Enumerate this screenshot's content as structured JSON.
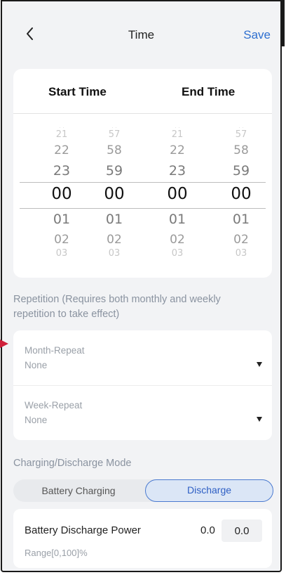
{
  "header": {
    "title": "Time",
    "save_label": "Save"
  },
  "picker": {
    "start_label": "Start Time",
    "end_label": "End Time",
    "start_hour": {
      "f1": "21",
      "f2": "22",
      "f3": "23",
      "sel": "00",
      "n1": "01",
      "n2": "02",
      "n3": "03"
    },
    "start_minute": {
      "f1": "57",
      "f2": "58",
      "f3": "59",
      "sel": "00",
      "n1": "01",
      "n2": "02",
      "n3": "03"
    },
    "end_hour": {
      "f1": "21",
      "f2": "22",
      "f3": "23",
      "sel": "00",
      "n1": "01",
      "n2": "02",
      "n3": "03"
    },
    "end_minute": {
      "f1": "57",
      "f2": "58",
      "f3": "59",
      "sel": "00",
      "n1": "01",
      "n2": "02",
      "n3": "03"
    }
  },
  "repetition": {
    "label": "Repetition (Requires both monthly and weekly repetition to take effect)",
    "month": {
      "name": "Month-Repeat",
      "value": "None"
    },
    "week": {
      "name": "Week-Repeat",
      "value": "None"
    }
  },
  "mode": {
    "label": "Charging/Discharge Mode",
    "options": [
      "Battery Charging",
      "Discharge"
    ],
    "selected": "Discharge"
  },
  "power": {
    "label": "Battery Discharge Power",
    "value": "0.0",
    "input_value": "0.0",
    "range": "Range[0,100]%"
  },
  "colors": {
    "accent": "#2e6fd0",
    "marker": "#d0203a",
    "background": "#f2f3f5"
  }
}
